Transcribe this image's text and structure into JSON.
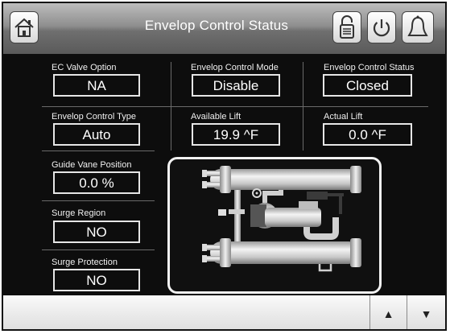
{
  "header": {
    "title": "Envelop Control Status",
    "home_icon": "home-icon",
    "lock_icon": "lock-icon",
    "power_icon": "power-icon",
    "alarm_icon": "alarm-bell-icon"
  },
  "fields": {
    "ec_valve_option": {
      "label": "EC Valve Option",
      "value": "NA"
    },
    "envelop_control_mode": {
      "label": "Envelop Control Mode",
      "value": "Disable"
    },
    "envelop_control_status": {
      "label": "Envelop Control Status",
      "value": "Closed"
    },
    "envelop_control_type": {
      "label": "Envelop Control Type",
      "value": "Auto"
    },
    "available_lift": {
      "label": "Available Lift",
      "value": "19.9 ^F"
    },
    "actual_lift": {
      "label": "Actual Lift",
      "value": "0.0 ^F"
    },
    "guide_vane_position": {
      "label": "Guide Vane Position",
      "value": "0.0 %"
    },
    "surge_region": {
      "label": "Surge Region",
      "value": "NO"
    },
    "surge_protection": {
      "label": "Surge Protection",
      "value": "NO"
    }
  },
  "footer": {
    "up_glyph": "▲",
    "down_glyph": "▼"
  },
  "colors": {
    "background": "#0d0d0d",
    "value_border": "#e6e6e6",
    "header_gradient_top": "#bdbdbd",
    "header_gradient_bottom": "#5a5a5a"
  }
}
